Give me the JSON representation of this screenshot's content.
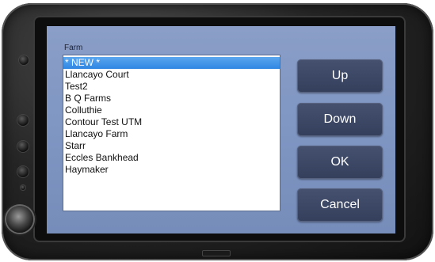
{
  "dialog": {
    "label": "Farm",
    "items": [
      "* NEW *",
      "Llancayo Court",
      "Test2",
      "B Q Farms",
      "Colluthie",
      "Contour Test UTM",
      "Llancayo Farm",
      "Starr",
      "Eccles Bankhead",
      "Haymaker"
    ],
    "selected_index": 0
  },
  "buttons": {
    "up": "Up",
    "down": "Down",
    "ok": "OK",
    "cancel": "Cancel"
  },
  "colors": {
    "screen_bg": "#8196c3",
    "selection": "#3a8fe6",
    "button_bg": "#3c4866"
  }
}
